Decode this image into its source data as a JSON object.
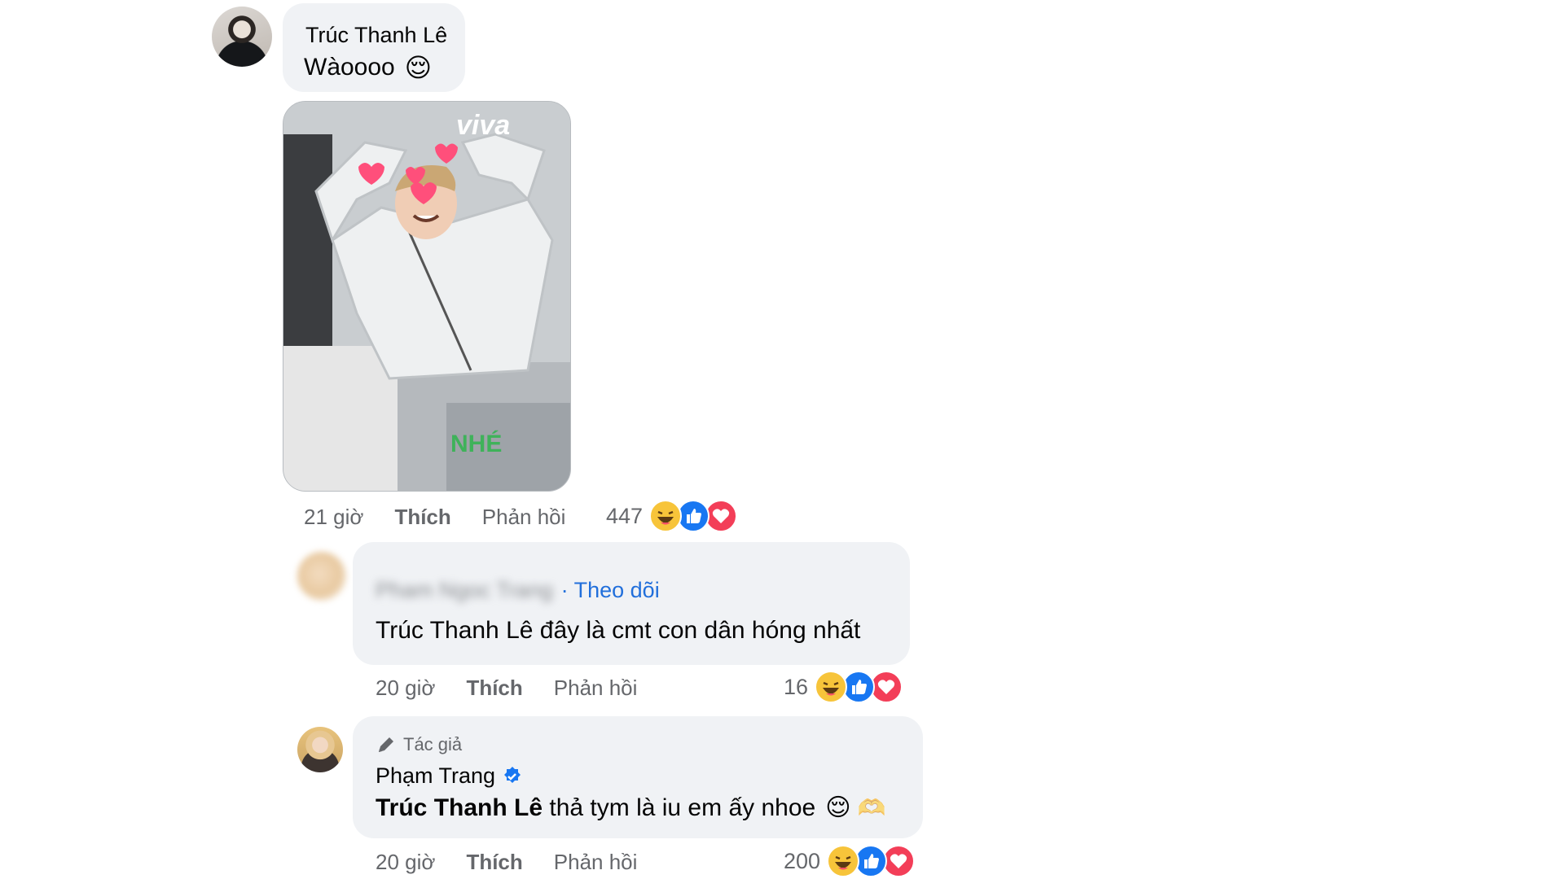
{
  "comment": {
    "author": "Trúc Thanh Lê",
    "text": "Wàoooo",
    "emoji": "😌",
    "gif_watermark_top": "viva",
    "gif_watermark_bottom": "NHÉ",
    "time": "21 giờ",
    "like": "Thích",
    "reply": "Phản hồi",
    "reaction_count": "447"
  },
  "replies": [
    {
      "author": "Pham Ngoc Trang",
      "follow": "Theo dõi",
      "tag": "Trúc Thanh Lê",
      "text": " đây là cmt con dân hóng nhất",
      "time": "20 giờ",
      "like": "Thích",
      "reply": "Phản hồi",
      "reaction_count": "16"
    },
    {
      "author_label": "Tác giả",
      "author": "Phạm Trang",
      "tag": "Trúc Thanh Lê",
      "text": " thả tym là iu em ấy nhoe",
      "emoji": "😌",
      "emoji2": "🫶",
      "time": "20 giờ",
      "like": "Thích",
      "reply": "Phản hồi",
      "reaction_count": "200"
    }
  ],
  "colors": {
    "bubble": "#f0f2f5",
    "meta_text": "#65676b",
    "link_blue": "#216fdb",
    "like_blue": "#1877f2",
    "love_red": "#f33e58",
    "haha_yellow": "#f7c43a"
  },
  "icons": [
    "haha-reaction-icon",
    "like-reaction-icon",
    "love-reaction-icon",
    "verified-badge-icon",
    "pen-icon"
  ]
}
